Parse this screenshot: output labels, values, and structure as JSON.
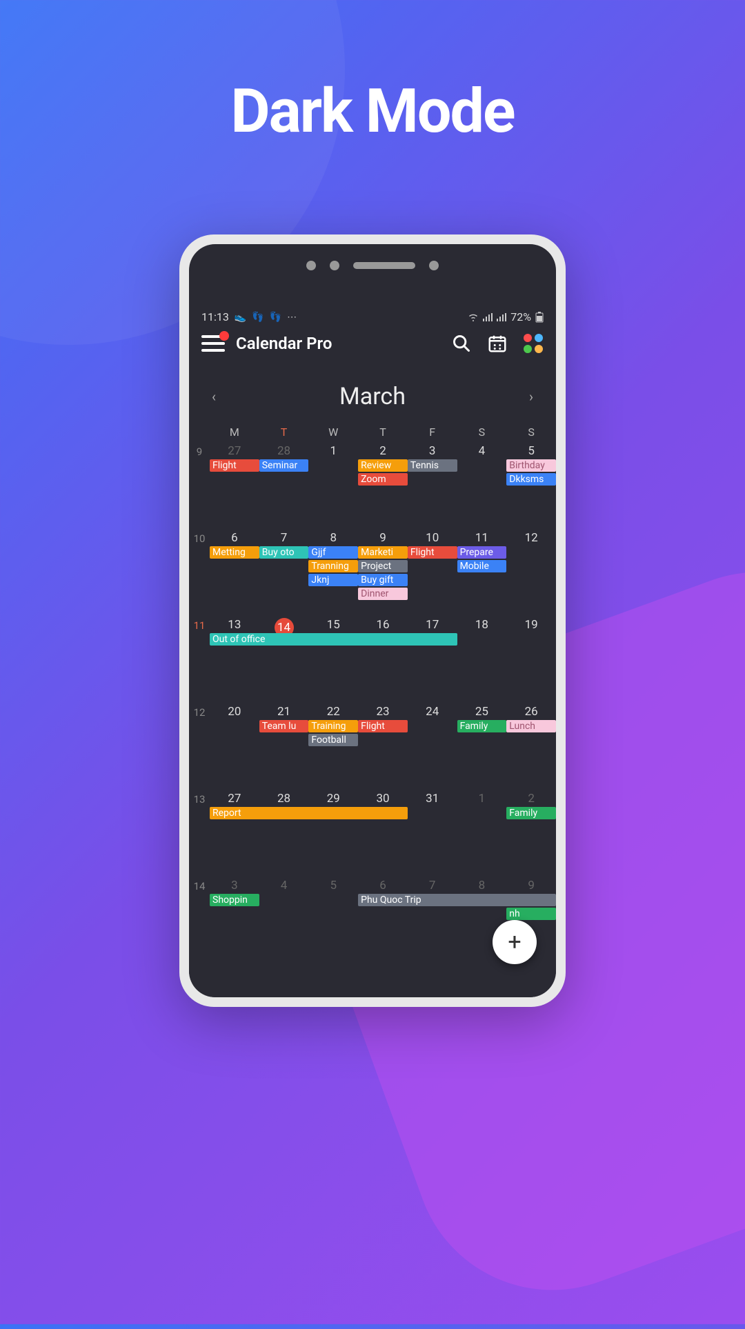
{
  "headline": "Dark Mode",
  "status": {
    "time": "11:13",
    "battery": "72%"
  },
  "app": {
    "title": "Calendar Pro",
    "dot_colors": [
      "#ff4d4d",
      "#4db8ff",
      "#4dc94d",
      "#ffb84d"
    ]
  },
  "month": "March",
  "day_headers": [
    "M",
    "T",
    "W",
    "T",
    "F",
    "S",
    "S"
  ],
  "today_col": 1,
  "weeks": [
    {
      "num": "9",
      "cur": false,
      "days": [
        {
          "n": "27",
          "o": true
        },
        {
          "n": "28",
          "o": true
        },
        {
          "n": "1"
        },
        {
          "n": "2"
        },
        {
          "n": "3"
        },
        {
          "n": "4"
        },
        {
          "n": "5"
        }
      ]
    },
    {
      "num": "10",
      "cur": false,
      "days": [
        {
          "n": "6"
        },
        {
          "n": "7"
        },
        {
          "n": "8"
        },
        {
          "n": "9"
        },
        {
          "n": "10"
        },
        {
          "n": "11"
        },
        {
          "n": "12"
        }
      ]
    },
    {
      "num": "11",
      "cur": true,
      "days": [
        {
          "n": "13"
        },
        {
          "n": "14",
          "today": true
        },
        {
          "n": "15"
        },
        {
          "n": "16"
        },
        {
          "n": "17"
        },
        {
          "n": "18"
        },
        {
          "n": "19"
        }
      ]
    },
    {
      "num": "12",
      "cur": false,
      "days": [
        {
          "n": "20"
        },
        {
          "n": "21"
        },
        {
          "n": "22"
        },
        {
          "n": "23"
        },
        {
          "n": "24"
        },
        {
          "n": "25"
        },
        {
          "n": "26"
        }
      ]
    },
    {
      "num": "13",
      "cur": false,
      "days": [
        {
          "n": "27"
        },
        {
          "n": "28"
        },
        {
          "n": "29"
        },
        {
          "n": "30"
        },
        {
          "n": "31"
        },
        {
          "n": "1",
          "o": true
        },
        {
          "n": "2",
          "o": true
        }
      ]
    },
    {
      "num": "14",
      "cur": false,
      "days": [
        {
          "n": "3",
          "o": true
        },
        {
          "n": "4",
          "o": true
        },
        {
          "n": "5",
          "o": true
        },
        {
          "n": "6",
          "o": true
        },
        {
          "n": "7",
          "o": true
        },
        {
          "n": "8",
          "o": true
        },
        {
          "n": "9",
          "o": true
        }
      ]
    }
  ],
  "colors": {
    "red": "#e74c3c",
    "blue": "#3b82f6",
    "orange": "#f59e0b",
    "gray": "#6b7280",
    "pink": "#f8a5c2",
    "teal": "#2ec4b6",
    "green": "#1abc9c",
    "purple": "#6c5ce7",
    "lightpink": "#f8c8dc",
    "dgreen": "#27ae60"
  },
  "events": [
    {
      "week": 0,
      "row": 0,
      "items": [
        {
          "start": 0,
          "span": 1,
          "label": "Flight",
          "c": "red"
        },
        {
          "start": 1,
          "span": 1,
          "label": "Seminar",
          "c": "blue"
        },
        {
          "start": 3,
          "span": 1,
          "label": "Review",
          "c": "orange"
        },
        {
          "start": 4,
          "span": 1,
          "label": "Tennis",
          "c": "gray"
        },
        {
          "start": 6,
          "span": 1,
          "label": "Birthday",
          "c": "lightpink"
        }
      ]
    },
    {
      "week": 0,
      "row": 1,
      "items": [
        {
          "start": 3,
          "span": 1,
          "label": "Zoom",
          "c": "red"
        },
        {
          "start": 6,
          "span": 1,
          "label": "Dkksms",
          "c": "blue"
        }
      ]
    },
    {
      "week": 1,
      "row": 0,
      "items": [
        {
          "start": 0,
          "span": 1,
          "label": "Metting",
          "c": "orange"
        },
        {
          "start": 1,
          "span": 1,
          "label": "Buy oto",
          "c": "teal"
        },
        {
          "start": 2,
          "span": 1,
          "label": "Gjjf",
          "c": "blue"
        },
        {
          "start": 3,
          "span": 1,
          "label": "Marketi",
          "c": "orange"
        },
        {
          "start": 4,
          "span": 1,
          "label": "Flight",
          "c": "red"
        },
        {
          "start": 5,
          "span": 1,
          "label": "Prepare",
          "c": "purple"
        }
      ]
    },
    {
      "week": 1,
      "row": 1,
      "items": [
        {
          "start": 2,
          "span": 1,
          "label": "Tranning",
          "c": "orange"
        },
        {
          "start": 3,
          "span": 1,
          "label": "Project",
          "c": "gray"
        },
        {
          "start": 5,
          "span": 1,
          "label": "Mobile",
          "c": "blue"
        }
      ]
    },
    {
      "week": 1,
      "row": 2,
      "items": [
        {
          "start": 2,
          "span": 1,
          "label": "Jknj",
          "c": "blue"
        },
        {
          "start": 3,
          "span": 1,
          "label": "Buy gift",
          "c": "blue"
        }
      ]
    },
    {
      "week": 1,
      "row": 3,
      "items": [
        {
          "start": 3,
          "span": 1,
          "label": "Dinner",
          "c": "lightpink"
        }
      ]
    },
    {
      "week": 2,
      "row": 0,
      "items": [
        {
          "start": 0,
          "span": 5,
          "label": "Out of office",
          "c": "teal"
        }
      ]
    },
    {
      "week": 3,
      "row": 0,
      "items": [
        {
          "start": 1,
          "span": 1,
          "label": "Team lu",
          "c": "red"
        },
        {
          "start": 2,
          "span": 1,
          "label": "Training",
          "c": "orange"
        },
        {
          "start": 3,
          "span": 1,
          "label": "Flight",
          "c": "red"
        },
        {
          "start": 5,
          "span": 1,
          "label": "Family",
          "c": "dgreen"
        },
        {
          "start": 6,
          "span": 1,
          "label": "Lunch",
          "c": "lightpink"
        }
      ]
    },
    {
      "week": 3,
      "row": 1,
      "items": [
        {
          "start": 2,
          "span": 1,
          "label": "Football",
          "c": "gray"
        }
      ]
    },
    {
      "week": 4,
      "row": 0,
      "items": [
        {
          "start": 0,
          "span": 4,
          "label": "Report",
          "c": "orange"
        },
        {
          "start": 6,
          "span": 1,
          "label": "Family",
          "c": "dgreen"
        }
      ]
    },
    {
      "week": 5,
      "row": 0,
      "items": [
        {
          "start": 0,
          "span": 1,
          "label": "Shoppin",
          "c": "dgreen"
        },
        {
          "start": 3,
          "span": 4,
          "label": "Phu Quoc Trip",
          "c": "gray"
        }
      ]
    },
    {
      "week": 5,
      "row": 1,
      "items": [
        {
          "start": 6,
          "span": 1,
          "label": "nh",
          "c": "dgreen"
        }
      ]
    }
  ],
  "fab": "+"
}
